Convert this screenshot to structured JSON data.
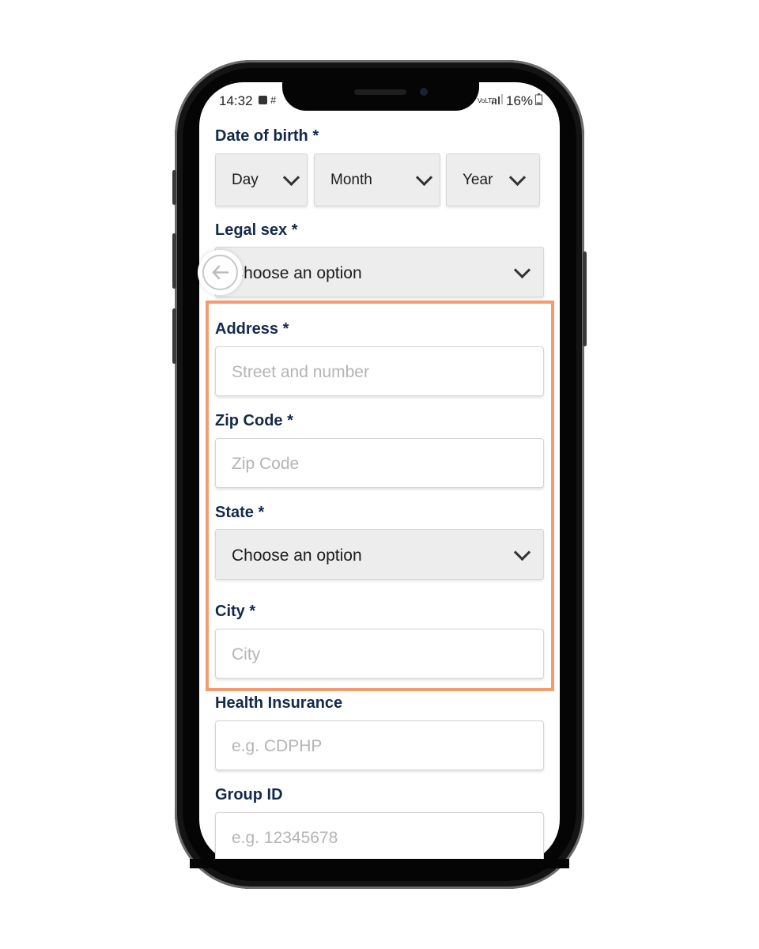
{
  "status_bar": {
    "time": "14:32",
    "battery": "16%",
    "network": "VoLTE"
  },
  "form": {
    "dob": {
      "label": "Date of birth *",
      "day": "Day",
      "month": "Month",
      "year": "Year"
    },
    "legal_sex": {
      "label": "Legal sex *",
      "value": "Choose an option"
    },
    "address": {
      "label": "Address *",
      "placeholder": "Street and number"
    },
    "zip": {
      "label": "Zip Code *",
      "placeholder": "Zip Code"
    },
    "state": {
      "label": "State *",
      "value": "Choose an option"
    },
    "city": {
      "label": "City *",
      "placeholder": "City"
    },
    "health_insurance": {
      "label": "Health Insurance",
      "placeholder": "e.g. CDPHP"
    },
    "group_id": {
      "label": "Group ID",
      "placeholder": "e.g. 12345678"
    }
  },
  "colors": {
    "label": "#13294b",
    "highlight": "#f69a70",
    "select_bg": "#ededed"
  },
  "icons": {
    "back": "arrow-left-circle",
    "dropdown": "chevron-down"
  }
}
